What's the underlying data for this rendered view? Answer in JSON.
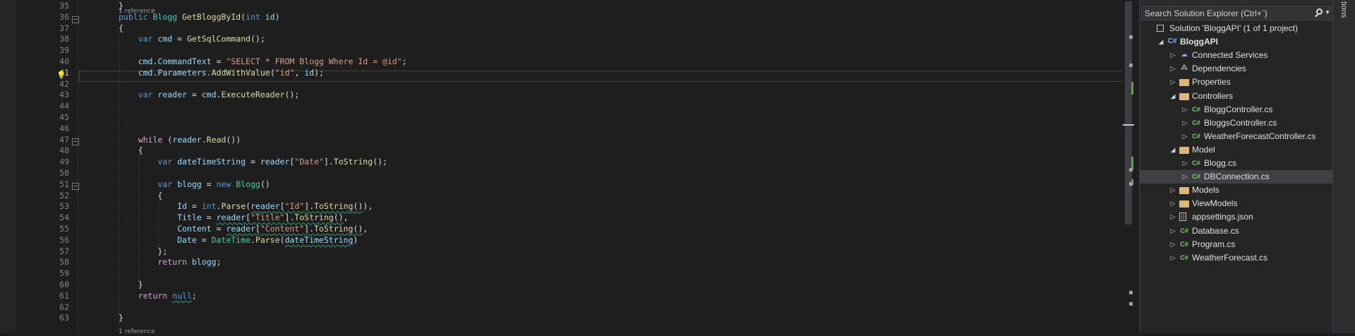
{
  "editor": {
    "active_line": "41",
    "codelens_top": "1 reference",
    "codelens_bottom": "1 reference",
    "lines": [
      {
        "n": "35",
        "tokens": [
          {
            "c": "txt",
            "t": "}"
          }
        ]
      },
      {
        "n": "36",
        "tokens": [
          {
            "c": "kw",
            "t": "public "
          },
          {
            "c": "ty",
            "t": "Blogg "
          },
          {
            "c": "fn",
            "t": "GetBloggById"
          },
          {
            "c": "txt",
            "t": "("
          },
          {
            "c": "kw",
            "t": "int "
          },
          {
            "c": "var",
            "t": "id"
          },
          {
            "c": "txt",
            "t": ")"
          }
        ]
      },
      {
        "n": "37",
        "tokens": [
          {
            "c": "txt",
            "t": "{"
          }
        ]
      },
      {
        "n": "38",
        "tokens": [
          {
            "c": "kw",
            "t": "    var "
          },
          {
            "c": "var",
            "t": "cmd"
          },
          {
            "c": "txt",
            "t": " = "
          },
          {
            "c": "fn",
            "t": "GetSqlCommand"
          },
          {
            "c": "txt",
            "t": "();"
          }
        ]
      },
      {
        "n": "39",
        "tokens": []
      },
      {
        "n": "40",
        "tokens": [
          {
            "c": "var",
            "t": "    cmd"
          },
          {
            "c": "txt",
            "t": "."
          },
          {
            "c": "var",
            "t": "CommandText"
          },
          {
            "c": "txt",
            "t": " = "
          },
          {
            "c": "str",
            "t": "\"SELECT * FROM Blogg Where Id = @id\""
          },
          {
            "c": "txt",
            "t": ";"
          }
        ]
      },
      {
        "n": "41",
        "tokens": [
          {
            "c": "var",
            "t": "    cmd"
          },
          {
            "c": "txt",
            "t": "."
          },
          {
            "c": "var",
            "t": "Parameters"
          },
          {
            "c": "txt",
            "t": "."
          },
          {
            "c": "fn",
            "t": "AddWithValue"
          },
          {
            "c": "txt",
            "t": "("
          },
          {
            "c": "str",
            "t": "\"id\""
          },
          {
            "c": "txt",
            "t": ", "
          },
          {
            "c": "var",
            "t": "id"
          },
          {
            "c": "txt",
            "t": ");"
          }
        ]
      },
      {
        "n": "42",
        "tokens": []
      },
      {
        "n": "43",
        "tokens": [
          {
            "c": "kw",
            "t": "    var "
          },
          {
            "c": "var",
            "t": "reader"
          },
          {
            "c": "txt",
            "t": " = "
          },
          {
            "c": "var",
            "t": "cmd"
          },
          {
            "c": "txt",
            "t": "."
          },
          {
            "c": "fn",
            "t": "ExecuteReader"
          },
          {
            "c": "txt",
            "t": "();"
          }
        ]
      },
      {
        "n": "44",
        "tokens": []
      },
      {
        "n": "45",
        "tokens": []
      },
      {
        "n": "46",
        "tokens": []
      },
      {
        "n": "47",
        "tokens": [
          {
            "c": "kw2",
            "t": "    while "
          },
          {
            "c": "txt",
            "t": "("
          },
          {
            "c": "var",
            "t": "reader"
          },
          {
            "c": "txt",
            "t": "."
          },
          {
            "c": "fn",
            "t": "Read"
          },
          {
            "c": "txt",
            "t": "())"
          }
        ]
      },
      {
        "n": "48",
        "tokens": [
          {
            "c": "txt",
            "t": "    {"
          }
        ]
      },
      {
        "n": "49",
        "tokens": [
          {
            "c": "kw",
            "t": "        var "
          },
          {
            "c": "var",
            "t": "dateTimeString"
          },
          {
            "c": "txt",
            "t": " = "
          },
          {
            "c": "var",
            "t": "reader"
          },
          {
            "c": "txt",
            "t": "["
          },
          {
            "c": "str",
            "t": "\"Date\""
          },
          {
            "c": "txt",
            "t": "]."
          },
          {
            "c": "fn",
            "t": "ToString"
          },
          {
            "c": "txt",
            "t": "();"
          }
        ]
      },
      {
        "n": "50",
        "tokens": []
      },
      {
        "n": "51",
        "tokens": [
          {
            "c": "kw",
            "t": "        var "
          },
          {
            "c": "var",
            "t": "blogg"
          },
          {
            "c": "txt",
            "t": " = "
          },
          {
            "c": "kw",
            "t": "new "
          },
          {
            "c": "ty",
            "t": "Blogg"
          },
          {
            "c": "txt",
            "t": "()"
          }
        ]
      },
      {
        "n": "52",
        "tokens": [
          {
            "c": "txt",
            "t": "        {"
          }
        ]
      },
      {
        "n": "53",
        "tokens": [
          {
            "c": "var",
            "t": "            Id"
          },
          {
            "c": "txt",
            "t": " = "
          },
          {
            "c": "kw",
            "t": "int"
          },
          {
            "c": "txt",
            "t": "."
          },
          {
            "c": "fn",
            "t": "Parse"
          },
          {
            "c": "txt",
            "t": "("
          },
          {
            "c": "var sq",
            "t": "reader"
          },
          {
            "c": "txt sq",
            "t": "["
          },
          {
            "c": "str sq",
            "t": "\"Id\""
          },
          {
            "c": "txt sq",
            "t": "]."
          },
          {
            "c": "fn sq",
            "t": "ToString"
          },
          {
            "c": "txt sq",
            "t": "()"
          },
          {
            "c": "txt",
            "t": "),"
          }
        ]
      },
      {
        "n": "54",
        "tokens": [
          {
            "c": "var",
            "t": "            Title"
          },
          {
            "c": "txt",
            "t": " = "
          },
          {
            "c": "var sq",
            "t": "reader"
          },
          {
            "c": "txt sq",
            "t": "["
          },
          {
            "c": "str sq",
            "t": "\"Title\""
          },
          {
            "c": "txt sq",
            "t": "]."
          },
          {
            "c": "fn sq",
            "t": "ToString"
          },
          {
            "c": "txt sq",
            "t": "()"
          },
          {
            "c": "txt",
            "t": ","
          }
        ]
      },
      {
        "n": "55",
        "tokens": [
          {
            "c": "var",
            "t": "            Content"
          },
          {
            "c": "txt",
            "t": " = "
          },
          {
            "c": "var sq",
            "t": "reader"
          },
          {
            "c": "txt sq",
            "t": "["
          },
          {
            "c": "str sq",
            "t": "\"Content\""
          },
          {
            "c": "txt sq",
            "t": "]."
          },
          {
            "c": "fn sq",
            "t": "ToString"
          },
          {
            "c": "txt sq",
            "t": "()"
          },
          {
            "c": "txt",
            "t": ","
          }
        ]
      },
      {
        "n": "56",
        "tokens": [
          {
            "c": "var",
            "t": "            Date"
          },
          {
            "c": "txt",
            "t": " = "
          },
          {
            "c": "ty",
            "t": "DateTime"
          },
          {
            "c": "txt",
            "t": "."
          },
          {
            "c": "fn",
            "t": "Parse"
          },
          {
            "c": "txt",
            "t": "("
          },
          {
            "c": "var sq",
            "t": "dateTimeString"
          },
          {
            "c": "txt",
            "t": ")"
          }
        ]
      },
      {
        "n": "57",
        "tokens": [
          {
            "c": "txt",
            "t": "        };"
          }
        ]
      },
      {
        "n": "58",
        "tokens": [
          {
            "c": "kw2",
            "t": "        return "
          },
          {
            "c": "var",
            "t": "blogg"
          },
          {
            "c": "txt",
            "t": ";"
          }
        ]
      },
      {
        "n": "59",
        "tokens": []
      },
      {
        "n": "60",
        "tokens": [
          {
            "c": "txt",
            "t": "    }"
          }
        ]
      },
      {
        "n": "61",
        "tokens": [
          {
            "c": "kw2",
            "t": "    return "
          },
          {
            "c": "kw sq",
            "t": "null"
          },
          {
            "c": "txt",
            "t": ";"
          }
        ]
      },
      {
        "n": "62",
        "tokens": []
      },
      {
        "n": "63",
        "tokens": [
          {
            "c": "txt",
            "t": "}"
          }
        ]
      }
    ]
  },
  "solution_explorer": {
    "search_placeholder": "Search Solution Explorer (Ctrl+¨)",
    "items": [
      {
        "label": "Solution 'BloggAPI' (1 of 1 project)",
        "icon": "solution-icon",
        "arrow": "",
        "depth": 0,
        "bold": false
      },
      {
        "label": "BloggAPI",
        "icon": "csharp-project-icon",
        "arrow": "expanded",
        "depth": 1,
        "bold": true
      },
      {
        "label": "Connected Services",
        "icon": "connected-services-icon",
        "arrow": "collapsed",
        "depth": 2,
        "bold": false
      },
      {
        "label": "Dependencies",
        "icon": "dependencies-icon",
        "arrow": "collapsed",
        "depth": 2,
        "bold": false
      },
      {
        "label": "Properties",
        "icon": "folder-icon",
        "arrow": "collapsed",
        "depth": 2,
        "bold": false
      },
      {
        "label": "Controllers",
        "icon": "folder-icon",
        "arrow": "expanded",
        "depth": 2,
        "bold": false
      },
      {
        "label": "BloggController.cs",
        "icon": "csharp-file-icon",
        "arrow": "collapsed",
        "depth": 3,
        "bold": false
      },
      {
        "label": "BloggsController.cs",
        "icon": "csharp-file-icon",
        "arrow": "collapsed",
        "depth": 3,
        "bold": false
      },
      {
        "label": "WeatherForecastController.cs",
        "icon": "csharp-file-icon",
        "arrow": "collapsed",
        "depth": 3,
        "bold": false
      },
      {
        "label": "Model",
        "icon": "folder-icon",
        "arrow": "expanded",
        "depth": 2,
        "bold": false
      },
      {
        "label": "Blogg.cs",
        "icon": "csharp-file-icon",
        "arrow": "collapsed",
        "depth": 3,
        "bold": false
      },
      {
        "label": "DBConnection.cs",
        "icon": "csharp-file-icon",
        "arrow": "collapsed",
        "depth": 3,
        "bold": false,
        "selected": true
      },
      {
        "label": "Models",
        "icon": "folder-icon",
        "arrow": "collapsed",
        "depth": 2,
        "bold": false
      },
      {
        "label": "ViewModels",
        "icon": "folder-icon",
        "arrow": "collapsed",
        "depth": 2,
        "bold": false
      },
      {
        "label": "appsettings.json",
        "icon": "json-file-icon",
        "arrow": "collapsed",
        "depth": 2,
        "bold": false
      },
      {
        "label": "Database.cs",
        "icon": "csharp-file-icon",
        "arrow": "collapsed",
        "depth": 2,
        "bold": false
      },
      {
        "label": "Program.cs",
        "icon": "csharp-file-icon",
        "arrow": "collapsed",
        "depth": 2,
        "bold": false
      },
      {
        "label": "WeatherForecast.cs",
        "icon": "csharp-file-icon",
        "arrow": "collapsed",
        "depth": 2,
        "bold": false
      }
    ]
  },
  "right_dock": {
    "tab_label": "tions"
  },
  "colors": {
    "editor_bg": "#1e1e1e",
    "keyword": "#569cd6",
    "control_keyword": "#d8a0df",
    "type": "#4ec9b0",
    "method": "#dcdcaa",
    "variable": "#9cdcfe",
    "string": "#d69d85",
    "selection": "#3f3f46",
    "change_marker": "#57a64a"
  }
}
